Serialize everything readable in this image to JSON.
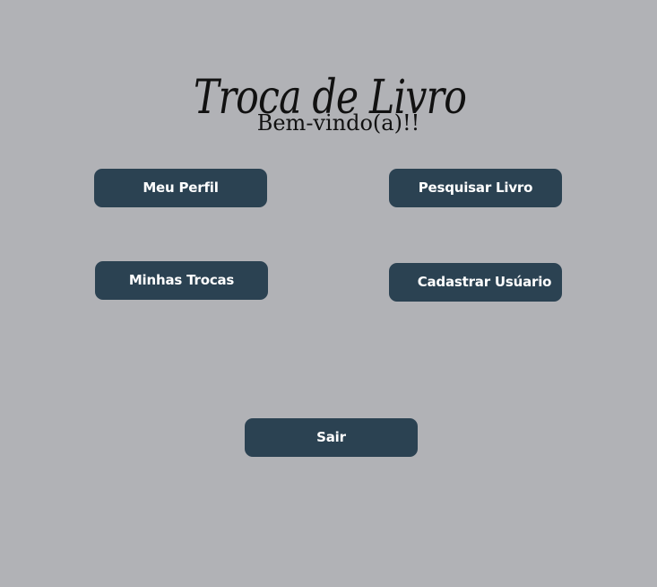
{
  "header": {
    "title": "Troca de Livro",
    "welcome": "Bem-vindo(a)!!"
  },
  "menu": {
    "profile_label": "Meu Perfil",
    "search_book_label": "Pesquisar Livro",
    "my_trades_label": "Minhas Trocas",
    "register_user_label": "Cadastrar Usúario",
    "logout_label": "Sair"
  },
  "colors": {
    "background": "#b1b2b6",
    "button": "#2b4252",
    "button_text": "#ffffff",
    "heading_text": "#111111"
  }
}
